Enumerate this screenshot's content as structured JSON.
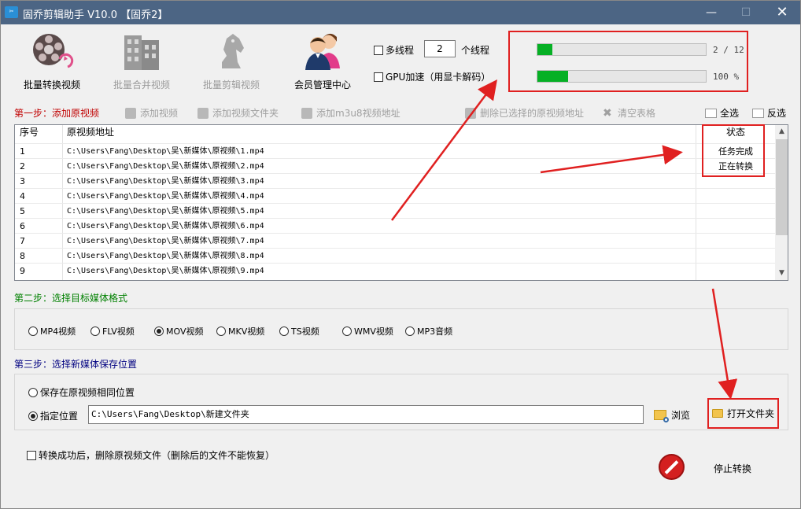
{
  "window": {
    "title": "固乔剪辑助手 V10.0 【固乔2】",
    "minimize": "—",
    "maximize": "☐",
    "close": "✕"
  },
  "toolbar": {
    "batch_convert": "批量转换视频",
    "batch_merge": "批量合并视频",
    "batch_cut": "批量剪辑视频",
    "member_center": "会员管理中心"
  },
  "options": {
    "multithread_label": "多线程",
    "thread_count": "2",
    "thread_unit": "个线程",
    "gpu_label": "GPU加速（用显卡解码）"
  },
  "progress": {
    "files_text": "2 / 12",
    "files_fraction": 0.09,
    "percent_text": "100 %",
    "percent_fraction": 0.18
  },
  "step1": {
    "label": "第一步：添加原视频",
    "add_video": "添加视频",
    "add_folder": "添加视频文件夹",
    "add_m3u8": "添加m3u8视频地址",
    "delete_selected": "删除已选择的原视频地址",
    "clear_table": "清空表格",
    "select_all": "全选",
    "invert": "反选"
  },
  "table": {
    "headers": {
      "no": "序号",
      "path": "原视频地址",
      "status": "状态"
    },
    "rows": [
      {
        "no": "1",
        "path": "C:\\Users\\Fang\\Desktop\\吴\\新媒体\\原视频\\1.mp4",
        "status": "任务完成"
      },
      {
        "no": "2",
        "path": "C:\\Users\\Fang\\Desktop\\吴\\新媒体\\原视频\\2.mp4",
        "status": "正在转换"
      },
      {
        "no": "3",
        "path": "C:\\Users\\Fang\\Desktop\\吴\\新媒体\\原视频\\3.mp4",
        "status": ""
      },
      {
        "no": "4",
        "path": "C:\\Users\\Fang\\Desktop\\吴\\新媒体\\原视频\\4.mp4",
        "status": ""
      },
      {
        "no": "5",
        "path": "C:\\Users\\Fang\\Desktop\\吴\\新媒体\\原视频\\5.mp4",
        "status": ""
      },
      {
        "no": "6",
        "path": "C:\\Users\\Fang\\Desktop\\吴\\新媒体\\原视频\\6.mp4",
        "status": ""
      },
      {
        "no": "7",
        "path": "C:\\Users\\Fang\\Desktop\\吴\\新媒体\\原视频\\7.mp4",
        "status": ""
      },
      {
        "no": "8",
        "path": "C:\\Users\\Fang\\Desktop\\吴\\新媒体\\原视频\\8.mp4",
        "status": ""
      },
      {
        "no": "9",
        "path": "C:\\Users\\Fang\\Desktop\\吴\\新媒体\\原视频\\9.mp4",
        "status": ""
      }
    ]
  },
  "step2": {
    "label": "第二步：选择目标媒体格式",
    "formats": [
      "MP4视频",
      "FLV视频",
      "MOV视频",
      "MKV视频",
      "TS视频",
      "WMV视频",
      "MP3音频"
    ],
    "selected": "MOV视频"
  },
  "step3": {
    "label": "第三步：选择新媒体保存位置",
    "same_location": "保存在原视频相同位置",
    "custom_location": "指定位置",
    "save_path": "C:\\Users\\Fang\\Desktop\\新建文件夹",
    "browse": "浏览",
    "open_folder": "打开文件夹"
  },
  "footer": {
    "delete_original": "转换成功后，删除原视频文件（删除后的文件不能恢复）",
    "stop": "停止转换"
  },
  "colors": {
    "titlebar": "#4c6584",
    "progress_fill": "#06b025",
    "highlight": "#e02020",
    "step1": "#c00000",
    "step2": "#008000",
    "step3": "#000080"
  }
}
